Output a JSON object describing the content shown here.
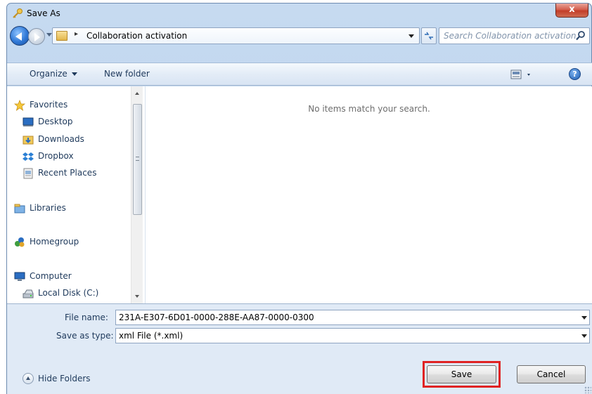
{
  "window": {
    "title": "Save As",
    "close_label": "x"
  },
  "address": {
    "path_label": "Collaboration activation",
    "separator": "▸"
  },
  "search": {
    "placeholder": "Search Collaboration activation"
  },
  "toolbar": {
    "organize_label": "Organize",
    "new_folder_label": "New folder",
    "help_label": "?"
  },
  "nav": {
    "favorites": "Favorites",
    "desktop": "Desktop",
    "downloads": "Downloads",
    "dropbox": "Dropbox",
    "recent_places": "Recent Places",
    "libraries": "Libraries",
    "homegroup": "Homegroup",
    "computer": "Computer",
    "local_disk": "Local Disk (C:)"
  },
  "content": {
    "empty_message": "No items match your search."
  },
  "form": {
    "file_name_label": "File name:",
    "file_name_value": "231A-E307-6D01-0000-288E-AA87-0000-0300",
    "save_type_label": "Save as type:",
    "save_type_value": "xml File (*.xml)"
  },
  "footer": {
    "hide_folders_label": "Hide Folders",
    "save_label": "Save",
    "cancel_label": "Cancel"
  },
  "colors": {
    "highlight": "#e02323",
    "title_bar": "#b8d0ec"
  }
}
